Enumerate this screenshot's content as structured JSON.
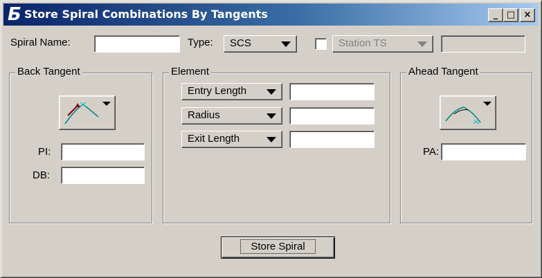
{
  "window": {
    "title": "Store Spiral Combinations By Tangents",
    "minimize_glyph": "_",
    "maximize_glyph": "□",
    "close_glyph": "×"
  },
  "top_row": {
    "spiral_name_label": "Spiral Name:",
    "spiral_name_value": "",
    "type_label": "Type:",
    "type_value": "SCS",
    "station_checked": false,
    "station_select_value": "Station TS",
    "station_value": ""
  },
  "back_tangent": {
    "title": "Back Tangent",
    "tool_icon": "back-tangent-spiral-icon",
    "pi_label": "PI:",
    "pi_value": "",
    "db_label": "DB:",
    "db_value": ""
  },
  "element": {
    "title": "Element",
    "rows": [
      {
        "label": "Entry Length",
        "value": ""
      },
      {
        "label": "Radius",
        "value": ""
      },
      {
        "label": "Exit Length",
        "value": ""
      }
    ]
  },
  "ahead_tangent": {
    "title": "Ahead Tangent",
    "tool_icon": "ahead-tangent-spiral-icon",
    "pa_label": "PA:",
    "pa_value": ""
  },
  "actions": {
    "store_label": "Store Spiral"
  },
  "colors": {
    "dialog_bg": "#d4d0c8",
    "title_gradient_start": "#0a246a",
    "title_gradient_end": "#a6caf0",
    "icon_curve": "#008080",
    "icon_arrow": "#800000"
  }
}
